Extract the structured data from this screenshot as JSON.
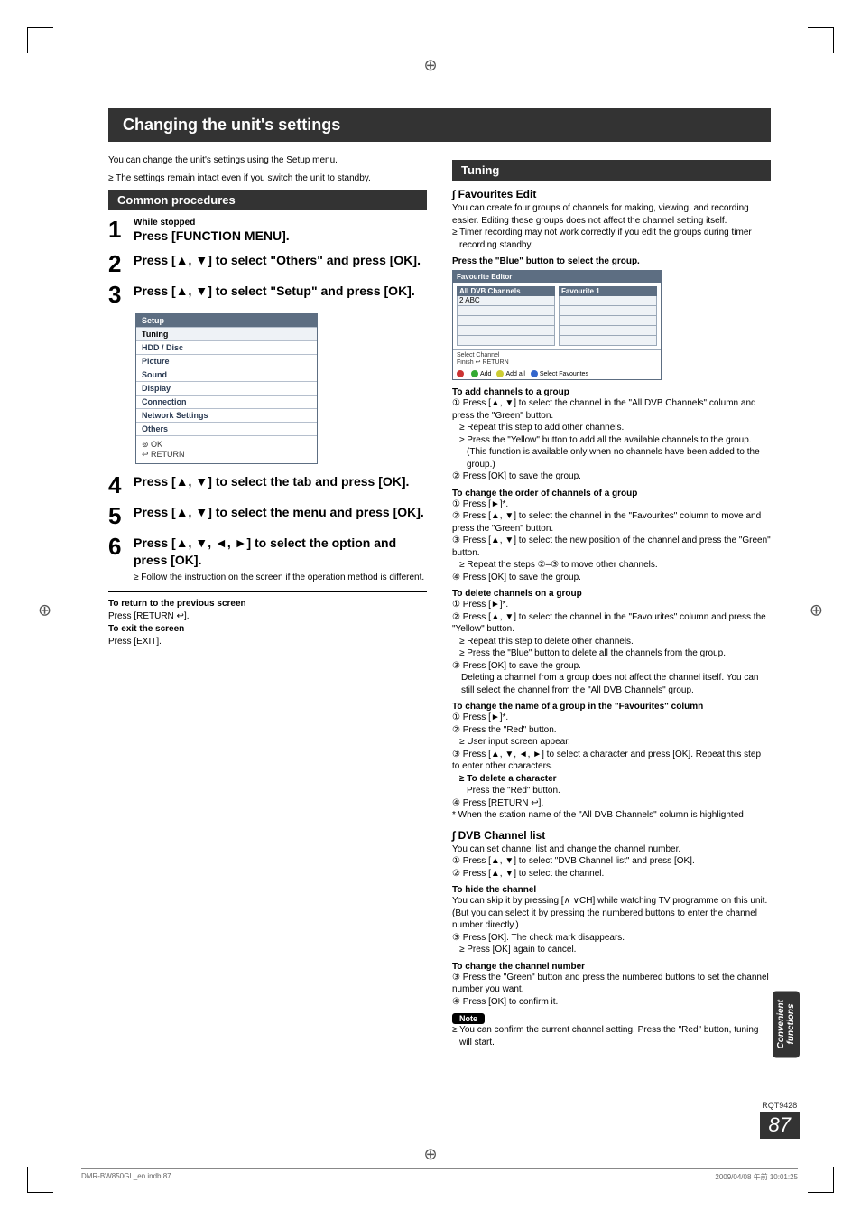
{
  "title_bar": "Changing the unit's settings",
  "intro_lines": [
    "You can change the unit's settings using the Setup menu.",
    "≥ The settings remain intact even if you switch the unit to standby."
  ],
  "common_header": "Common procedures",
  "steps": [
    {
      "num": "1",
      "small": "While stopped",
      "main": "Press [FUNCTION MENU]."
    },
    {
      "num": "2",
      "small": "",
      "main": "Press [▲, ▼] to select \"Others\" and press [OK]."
    },
    {
      "num": "3",
      "small": "",
      "main": "Press [▲, ▼] to select \"Setup\" and press [OK]."
    },
    {
      "num": "4",
      "small": "",
      "main": "Press [▲, ▼] to select the tab and press [OK]."
    },
    {
      "num": "5",
      "small": "",
      "main": "Press [▲, ▼] to select the menu and press [OK]."
    },
    {
      "num": "6",
      "small": "",
      "main": "Press [▲, ▼, ◄, ►] to select the option and press [OK].",
      "note": "≥ Follow the instruction on the screen if the operation method is different."
    }
  ],
  "setup_box": {
    "header": "Setup",
    "items": [
      "Tuning",
      "HDD / Disc",
      "Picture",
      "Sound",
      "Display",
      "Connection",
      "Network Settings",
      "Others"
    ],
    "foot_ok": "OK",
    "foot_return": "RETURN"
  },
  "return_block": {
    "l1": "To return to the previous screen",
    "l2": "Press [RETURN ↩].",
    "l3": "To exit the screen",
    "l4": "Press [EXIT]."
  },
  "tuning_header": "Tuning",
  "fav_edit_h": "Favourites Edit",
  "fav_edit_body": [
    "You can create four groups of channels for making, viewing, and recording easier. Editing these groups does not affect the channel setting itself.",
    "≥ Timer recording may not work correctly if you edit the groups during timer recording standby."
  ],
  "press_blue": "Press the \"Blue\" button to select the group.",
  "fav_editor": {
    "title": "Favourite Editor",
    "left_h": "All DVB Channels",
    "left_row": "2 ABC",
    "right_h": "Favourite 1",
    "mid1": "Select Channel",
    "mid2": "Finish",
    "mid3": "RETURN",
    "legend": [
      "",
      "Add",
      "Add all",
      "Select Favourites"
    ]
  },
  "add_ch_h": "To add channels to a group",
  "add_ch_lines": [
    "① Press [▲, ▼] to select the channel in the \"All DVB Channels\" column and press the \"Green\" button.",
    "≥ Repeat this step to add other channels.",
    "≥ Press the \"Yellow\" button to add all the available channels to the group. (This function is available only when no channels have been added to the group.)",
    "② Press [OK] to save the group."
  ],
  "order_h": "To change the order of channels of a group",
  "order_lines": [
    "① Press [►]*.",
    "② Press [▲, ▼] to select the channel in the \"Favourites\" column to move and press the \"Green\" button.",
    "③ Press [▲, ▼] to select the new position of the channel and press the \"Green\" button.",
    "≥ Repeat the steps ②–③ to move other channels.",
    "④ Press [OK] to save the group."
  ],
  "delete_h": "To delete channels on a group",
  "delete_lines": [
    "① Press [►]*.",
    "② Press [▲, ▼] to select the channel in the \"Favourites\" column and press the \"Yellow\" button.",
    "≥ Repeat this step to delete other channels.",
    "≥ Press the \"Blue\" button to delete all the channels from the group.",
    "③ Press [OK] to save the group.",
    "Deleting a channel from a group does not affect the channel itself. You can still select the channel from the \"All DVB Channels\" group."
  ],
  "rename_h": "To change the name of a group in the \"Favourites\" column",
  "rename_lines": [
    "① Press [►]*.",
    "② Press the \"Red\" button.",
    "≥ User input screen appear.",
    "③ Press [▲, ▼, ◄, ►] to select a character and press [OK]. Repeat this step to enter other characters.",
    "≥ To delete a character",
    "Press the \"Red\" button.",
    "④ Press [RETURN ↩].",
    "* When the station name of the \"All DVB Channels\" column is highlighted"
  ],
  "dvb_h": "DVB Channel list",
  "dvb_lines": [
    "You can set channel list and change the channel number.",
    "① Press [▲, ▼] to select \"DVB Channel list\" and press [OK].",
    "② Press [▲, ▼] to select the channel."
  ],
  "hide_h": "To hide the channel",
  "hide_lines": [
    "You can skip it by pressing [∧ ∨CH] while watching TV programme on this unit.",
    "(But you can select it by pressing the numbered buttons to enter the channel number directly.)",
    "③ Press [OK]. The check mark disappears.",
    "≥ Press [OK] again to cancel."
  ],
  "chnum_h": "To change the channel number",
  "chnum_lines": [
    "③ Press the \"Green\" button and press the numbered buttons to set the channel number you want.",
    "④ Press [OK] to confirm it."
  ],
  "note_label": "Note",
  "note_line": "≥ You can confirm the current channel setting. Press the \"Red\" button, tuning will start.",
  "side_tab_1": "Convenient",
  "side_tab_2": "functions",
  "code": "RQT9428",
  "page_num": "87",
  "footer_left": "DMR-BW850GL_en.indb   87",
  "footer_right": "2009/04/08   午前 10:01:25"
}
